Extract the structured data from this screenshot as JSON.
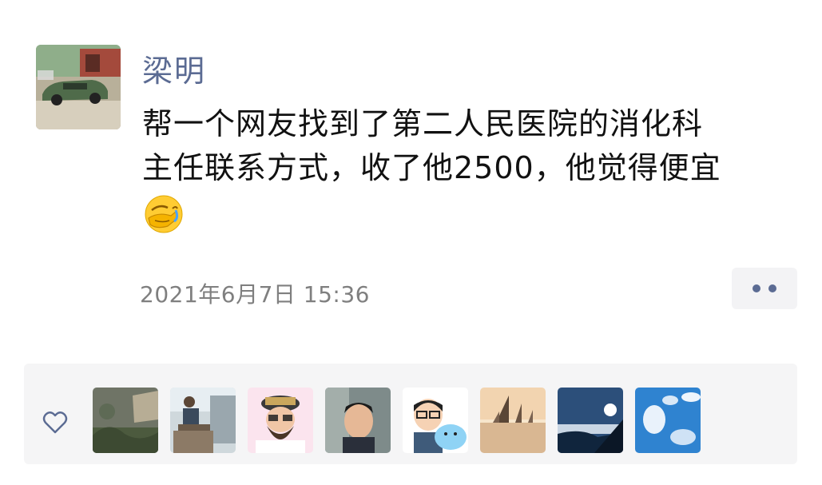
{
  "post": {
    "author": "梁明",
    "text": "帮一个网友找到了第二人民医院的消化科\n主任联系方式，收了他2500，他觉得便宜",
    "emoji": "face-palm-crying-emoji",
    "timestamp": "2021年6月7日 15:36"
  },
  "actions": {
    "more_icon": "two-dots-more-icon"
  },
  "likes": {
    "icon": "heart-outline-icon",
    "avatars": [
      {
        "name": "liker-avatar-1",
        "desc": "garden photo"
      },
      {
        "name": "liker-avatar-2",
        "desc": "man sitting on balcony"
      },
      {
        "name": "liker-avatar-3",
        "desc": "cartoon bearded man with hat"
      },
      {
        "name": "liker-avatar-4",
        "desc": "man portrait"
      },
      {
        "name": "liker-avatar-5",
        "desc": "cartoon boy with blue bear"
      },
      {
        "name": "liker-avatar-6",
        "desc": "sailboats at sunset"
      },
      {
        "name": "liker-avatar-7",
        "desc": "sea of clouds"
      },
      {
        "name": "liker-avatar-8",
        "desc": "blue sky with clouds"
      }
    ]
  },
  "colors": {
    "name_link": "#5b6b93",
    "text": "#111111",
    "timestamp": "#7f7f7f",
    "panel_bg": "#f5f5f6"
  }
}
